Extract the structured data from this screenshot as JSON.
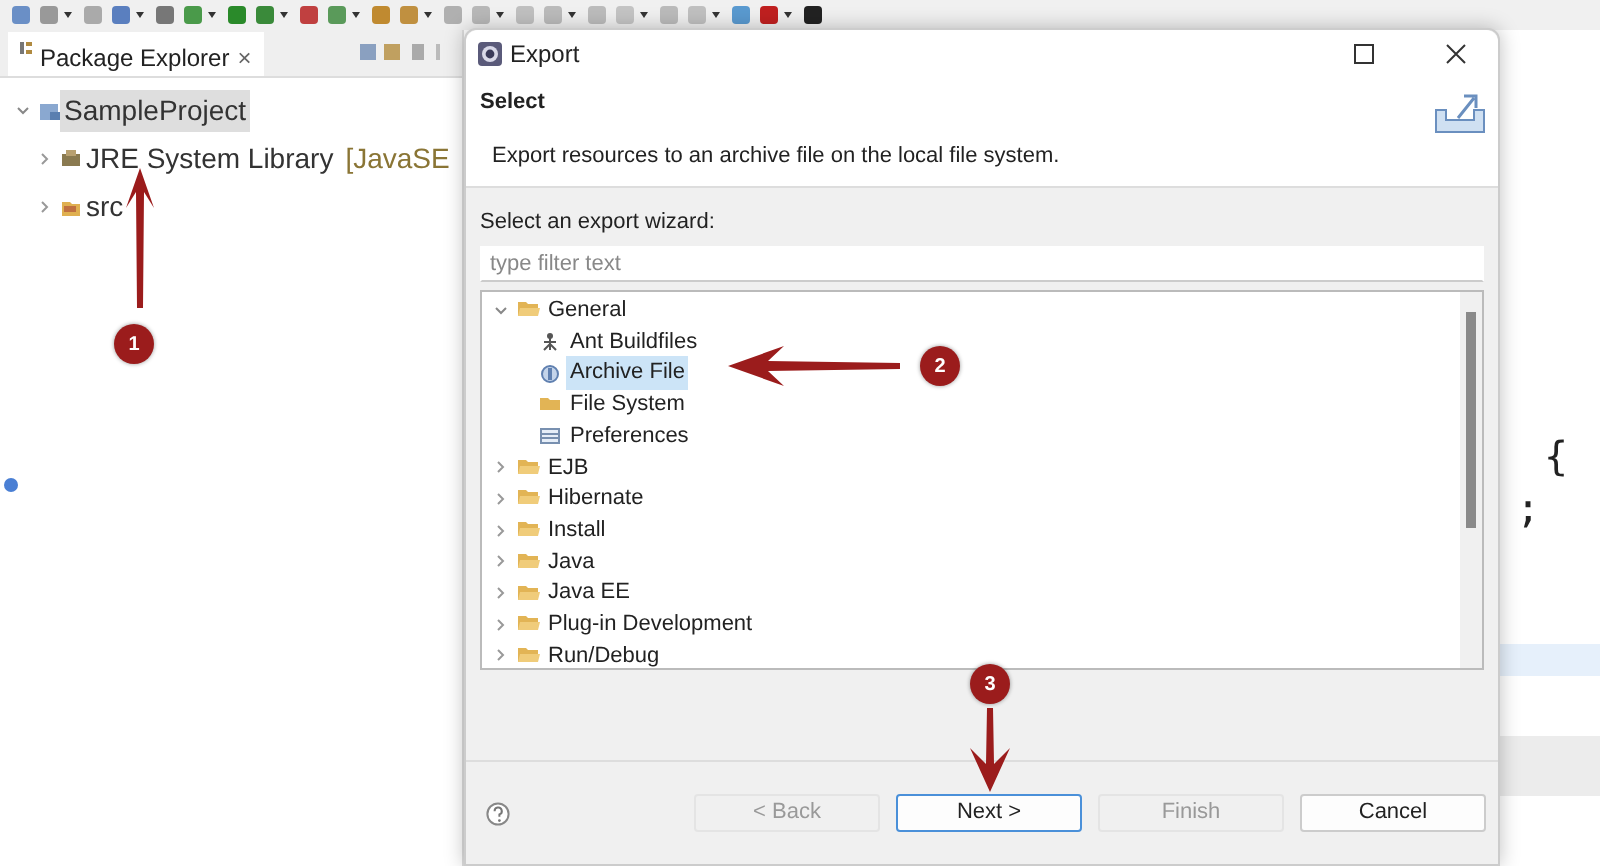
{
  "package_explorer": {
    "tab_label": "Package Explorer",
    "tab_close": "×",
    "tree": [
      {
        "label": "SampleProject",
        "kind": "project",
        "expanded": true,
        "selected": true,
        "children": [
          {
            "label": "JRE System Library",
            "suffix": "[JavaSE",
            "kind": "library",
            "expanded": false,
            "selected": false
          },
          {
            "label": "src",
            "kind": "package",
            "expanded": false,
            "selected": false
          }
        ]
      }
    ]
  },
  "editor": {
    "lines": [
      "{",
      ";"
    ]
  },
  "dialog": {
    "title": "Export",
    "page_title": "Select",
    "description": "Export resources to an archive file on the local file system.",
    "wizard_label": "Select an export wizard:",
    "filter": {
      "placeholder": "type filter text"
    },
    "tree": [
      {
        "label": "General",
        "kind": "folder",
        "expanded": true,
        "selected": false,
        "children": [
          {
            "label": "Ant Buildfiles",
            "kind": "ant",
            "selected": false
          },
          {
            "label": "Archive File",
            "kind": "archive",
            "selected": true
          },
          {
            "label": "File System",
            "kind": "filesystem",
            "selected": false
          },
          {
            "label": "Preferences",
            "kind": "preferences",
            "selected": false
          }
        ]
      },
      {
        "label": "EJB",
        "kind": "folder",
        "expanded": false,
        "selected": false
      },
      {
        "label": "Hibernate",
        "kind": "folder",
        "expanded": false,
        "selected": false
      },
      {
        "label": "Install",
        "kind": "folder",
        "expanded": false,
        "selected": false
      },
      {
        "label": "Java",
        "kind": "folder",
        "expanded": false,
        "selected": false
      },
      {
        "label": "Java EE",
        "kind": "folder",
        "expanded": false,
        "selected": false
      },
      {
        "label": "Plug-in Development",
        "kind": "folder",
        "expanded": false,
        "selected": false
      },
      {
        "label": "Run/Debug",
        "kind": "folder",
        "expanded": false,
        "selected": false
      }
    ],
    "buttons": [
      {
        "label": "< Back",
        "disabled": true,
        "default": false
      },
      {
        "label": "Next >",
        "disabled": false,
        "default": true
      },
      {
        "label": "Finish",
        "disabled": true,
        "default": false
      },
      {
        "label": "Cancel",
        "disabled": false,
        "default": false
      }
    ]
  },
  "annotations": [
    {
      "label": "1",
      "kind": "up"
    },
    {
      "label": "2",
      "kind": "left"
    },
    {
      "label": "3",
      "kind": "down"
    }
  ]
}
